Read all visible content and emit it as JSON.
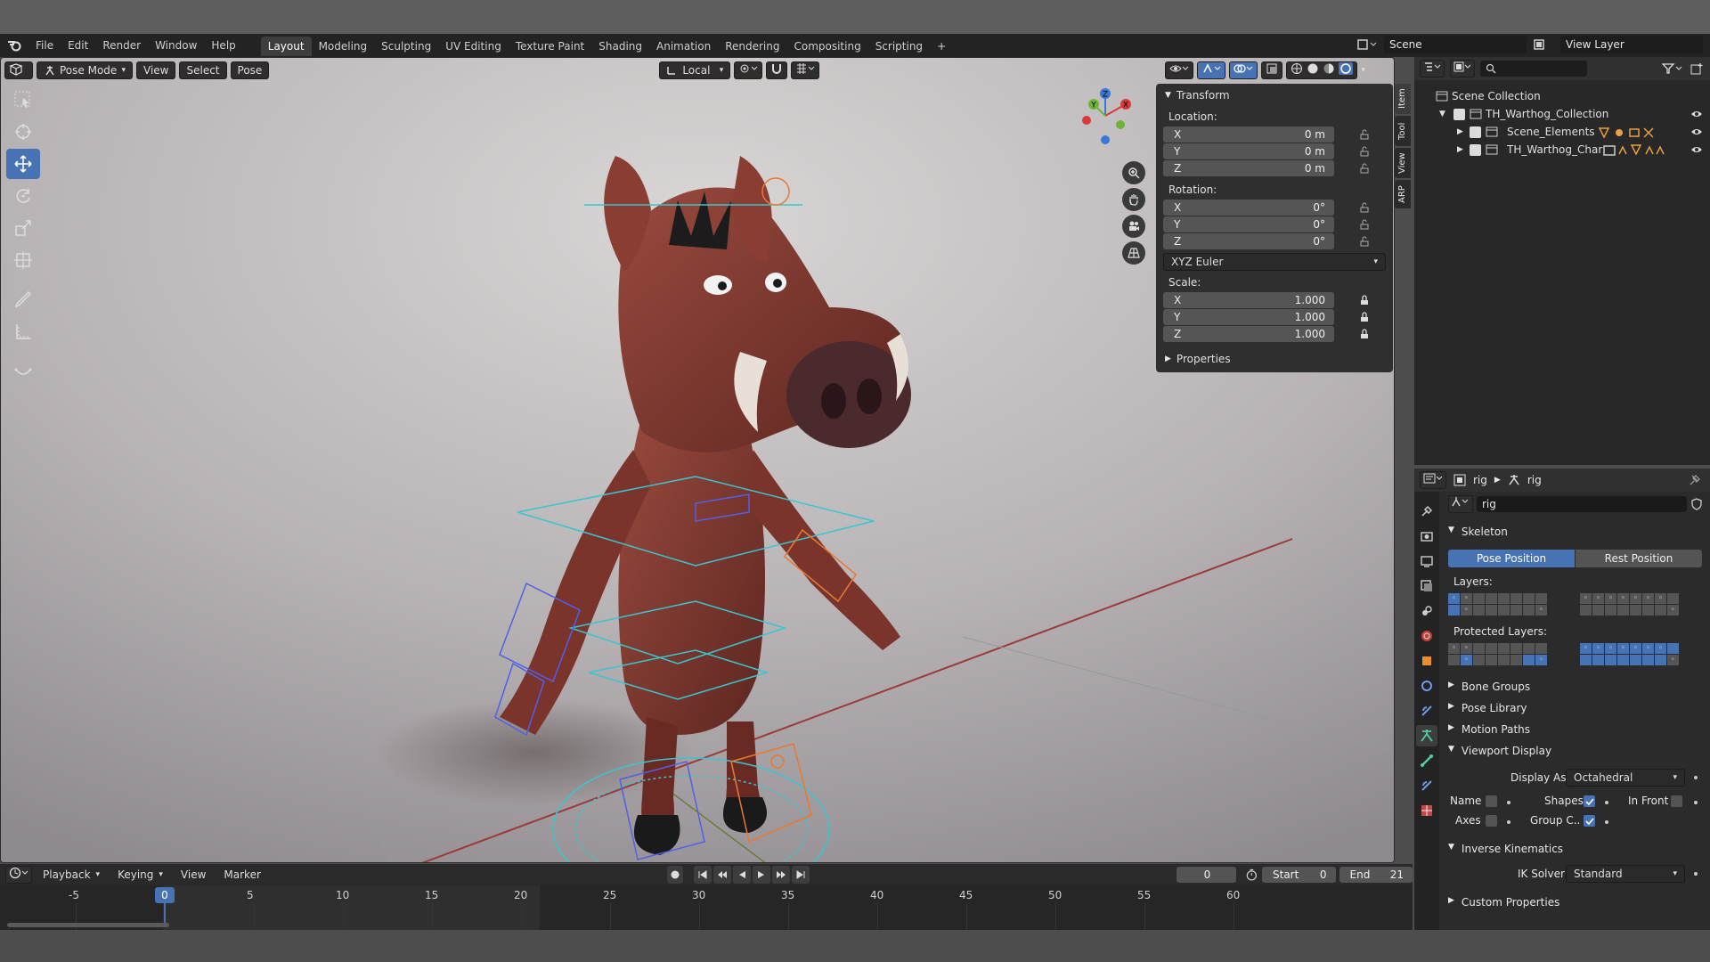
{
  "app": {
    "menus": [
      "File",
      "Edit",
      "Render",
      "Window",
      "Help"
    ],
    "workspaces": [
      "Layout",
      "Modeling",
      "Sculpting",
      "UV Editing",
      "Texture Paint",
      "Shading",
      "Animation",
      "Rendering",
      "Compositing",
      "Scripting"
    ],
    "active_workspace": "Layout",
    "add_tab_label": "+",
    "scene_name": "Scene",
    "view_layer_name": "View Layer"
  },
  "viewport": {
    "mode": "Pose Mode",
    "menus": [
      "View",
      "Select",
      "Pose"
    ],
    "transform_orientation": "Local",
    "gizmo_axes": {
      "x": "X",
      "y": "Y",
      "z": "Z"
    },
    "side_tabs": [
      "Item",
      "Tool",
      "View",
      "ARP"
    ]
  },
  "transform_panel": {
    "title": "Transform",
    "location_label": "Location:",
    "location": [
      {
        "axis": "X",
        "value": "0 m"
      },
      {
        "axis": "Y",
        "value": "0 m"
      },
      {
        "axis": "Z",
        "value": "0 m"
      }
    ],
    "rotation_label": "Rotation:",
    "rotation": [
      {
        "axis": "X",
        "value": "0°"
      },
      {
        "axis": "Y",
        "value": "0°"
      },
      {
        "axis": "Z",
        "value": "0°"
      }
    ],
    "rotation_mode": "XYZ Euler",
    "scale_label": "Scale:",
    "scale": [
      {
        "axis": "X",
        "value": "1.000"
      },
      {
        "axis": "Y",
        "value": "1.000"
      },
      {
        "axis": "Z",
        "value": "1.000"
      }
    ],
    "properties_label": "Properties"
  },
  "outliner": {
    "items": [
      "Scene Collection",
      "TH_Warthog_Collection",
      "Scene_Elements",
      "TH_Warthog_Char"
    ]
  },
  "properties": {
    "breadcrumb": [
      "rig",
      "rig"
    ],
    "datablock_name": "rig",
    "skeleton_label": "Skeleton",
    "pose_position_label": "Pose Position",
    "rest_position_label": "Rest Position",
    "layers_label": "Layers:",
    "protected_layers_label": "Protected Layers:",
    "collapsed_panels": [
      "Bone Groups",
      "Pose Library",
      "Motion Paths"
    ],
    "viewport_display_label": "Viewport Display",
    "display_as_label": "Display As",
    "display_as_value": "Octahedral",
    "checks": {
      "name": "Name",
      "shapes": "Shapes",
      "in_front": "In Front",
      "axes": "Axes",
      "group_colors": "Group C.."
    },
    "ik_label": "Inverse Kinematics",
    "ik_solver_label": "IK Solver",
    "ik_solver_value": "Standard",
    "custom_props_label": "Custom Properties"
  },
  "timeline": {
    "menus": [
      "Playback",
      "Keying",
      "View",
      "Marker"
    ],
    "current_frame": "0",
    "start_label": "Start",
    "start_value": "0",
    "end_label": "End",
    "end_value": "21",
    "ticks": [
      "-5",
      "0",
      "5",
      "10",
      "15",
      "20",
      "25",
      "30",
      "35",
      "40",
      "45",
      "50",
      "55",
      "60"
    ]
  }
}
